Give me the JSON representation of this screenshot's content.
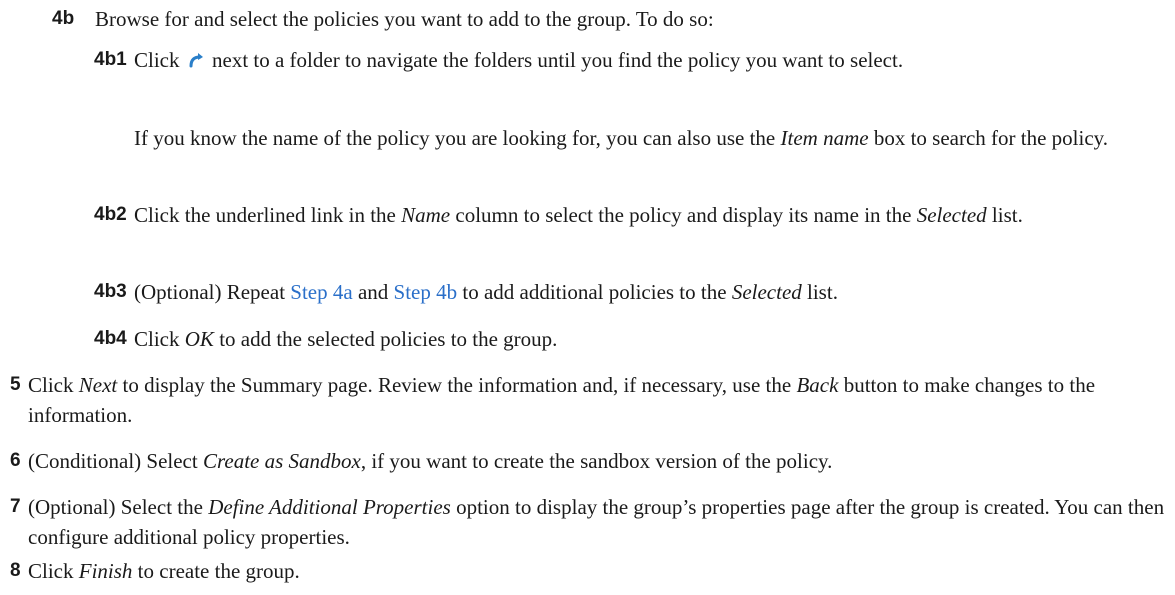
{
  "steps": {
    "s4b": {
      "num": "4b",
      "text": "Browse for and select the policies you want to add to the group. To do so:"
    },
    "s4b1": {
      "num": "4b1",
      "pre": "Click",
      "icon": "folder-navigate-arrow-icon",
      "post": "next to a folder to navigate the folders until you find the policy you want to select."
    },
    "s4b1_note": {
      "pre": "If you know the name of the policy you are looking for, you can also use the",
      "em": "Item name",
      "post": "box to search for the policy."
    },
    "s4b2": {
      "num": "4b2",
      "pre": "Click the underlined link in the",
      "em1": "Name",
      "mid": "column to select the policy and display its name in the",
      "em2": "Selected",
      "post": "list."
    },
    "s4b3": {
      "num": "4b3",
      "pre": "(Optional) Repeat",
      "link1": "Step 4a",
      "and": "and",
      "link2": "Step 4b",
      "mid": "to add additional policies to the",
      "em": "Selected",
      "post": "list."
    },
    "s4b4": {
      "num": "4b4",
      "pre": "Click",
      "em": "OK",
      "post": "to add the selected policies to the group."
    },
    "s5": {
      "num": "5",
      "pre": "Click",
      "em1": "Next",
      "mid": "to display the Summary page. Review the information and, if necessary, use the",
      "em2": "Back",
      "post": "button to make changes to the information."
    },
    "s6": {
      "num": "6",
      "pre": "(Conditional) Select",
      "em": "Create as Sandbox",
      "post": ", if you want to create the sandbox version of the policy."
    },
    "s7": {
      "num": "7",
      "pre": "(Optional) Select the",
      "em": "Define Additional Properties",
      "post": "option to display the group’s properties page after the group is created. You can then configure additional policy properties."
    },
    "s8": {
      "num": "8",
      "pre": "Click",
      "em": "Finish",
      "post": "to create the group."
    }
  },
  "colors": {
    "link": "#2a6fc9",
    "text": "#1a1a1a",
    "icon": "#2a7fc9"
  }
}
